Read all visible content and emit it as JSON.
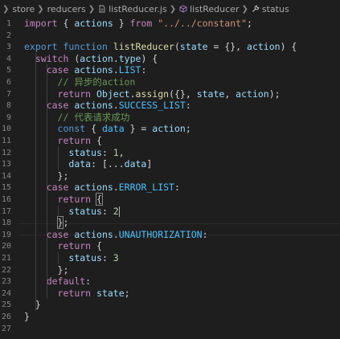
{
  "breadcrumb": {
    "items": [
      "store",
      "reducers",
      "listReducer.js",
      "listReducer",
      "status"
    ]
  },
  "editor": {
    "line_numbers": [
      "1",
      "2",
      "3",
      "4",
      "5",
      "6",
      "7",
      "8",
      "9",
      "10",
      "11",
      "12",
      "13",
      "14",
      "15",
      "16",
      "17",
      "18",
      "19",
      "20",
      "21",
      "22",
      "23",
      "24",
      "25",
      "26",
      "27"
    ],
    "lines": [
      [
        [
          "k",
          "import"
        ],
        [
          "p",
          " { "
        ],
        [
          "v",
          "actions"
        ],
        [
          "p",
          " } "
        ],
        [
          "k",
          "from"
        ],
        [
          "p",
          " "
        ],
        [
          "s",
          "\"../../constant\""
        ],
        [
          "p",
          ";"
        ]
      ],
      [],
      [
        [
          "kw",
          "export"
        ],
        [
          "p",
          " "
        ],
        [
          "kw",
          "function"
        ],
        [
          "p",
          " "
        ],
        [
          "f",
          "listReducer"
        ],
        [
          "p",
          "("
        ],
        [
          "v",
          "state"
        ],
        [
          "p",
          " = {}, "
        ],
        [
          "v",
          "action"
        ],
        [
          "p",
          ") {"
        ]
      ],
      [
        [
          "p",
          "  "
        ],
        [
          "k",
          "switch"
        ],
        [
          "p",
          " ("
        ],
        [
          "v",
          "action"
        ],
        [
          "p",
          "."
        ],
        [
          "v",
          "type"
        ],
        [
          "p",
          ") {"
        ]
      ],
      [
        [
          "p",
          "    "
        ],
        [
          "k",
          "case"
        ],
        [
          "p",
          " "
        ],
        [
          "v",
          "actions"
        ],
        [
          "p",
          "."
        ],
        [
          "cst",
          "LIST"
        ],
        [
          "p",
          ":"
        ]
      ],
      [
        [
          "p",
          "      "
        ],
        [
          "c",
          "// 异步的action"
        ]
      ],
      [
        [
          "p",
          "      "
        ],
        [
          "k",
          "return"
        ],
        [
          "p",
          " "
        ],
        [
          "v",
          "Object"
        ],
        [
          "p",
          "."
        ],
        [
          "f",
          "assign"
        ],
        [
          "p",
          "({}, "
        ],
        [
          "v",
          "state"
        ],
        [
          "p",
          ", "
        ],
        [
          "v",
          "action"
        ],
        [
          "p",
          ");"
        ]
      ],
      [
        [
          "p",
          "    "
        ],
        [
          "k",
          "case"
        ],
        [
          "p",
          " "
        ],
        [
          "v",
          "actions"
        ],
        [
          "p",
          "."
        ],
        [
          "cst",
          "SUCCESS_LIST"
        ],
        [
          "p",
          ":"
        ]
      ],
      [
        [
          "p",
          "      "
        ],
        [
          "c",
          "// 代表请求成功"
        ]
      ],
      [
        [
          "p",
          "      "
        ],
        [
          "kw",
          "const"
        ],
        [
          "p",
          " { "
        ],
        [
          "cst",
          "data"
        ],
        [
          "p",
          " } = "
        ],
        [
          "v",
          "action"
        ],
        [
          "p",
          ";"
        ]
      ],
      [
        [
          "p",
          "      "
        ],
        [
          "k",
          "return"
        ],
        [
          "p",
          " {"
        ]
      ],
      [
        [
          "p",
          "        "
        ],
        [
          "v",
          "status"
        ],
        [
          "p",
          ": "
        ],
        [
          "n",
          "1"
        ],
        [
          "p",
          ","
        ]
      ],
      [
        [
          "p",
          "        "
        ],
        [
          "v",
          "data"
        ],
        [
          "p",
          ": [..."
        ],
        [
          "v",
          "data"
        ],
        [
          "p",
          "]"
        ]
      ],
      [
        [
          "p",
          "      };"
        ]
      ],
      [
        [
          "p",
          "    "
        ],
        [
          "k",
          "case"
        ],
        [
          "p",
          " "
        ],
        [
          "v",
          "actions"
        ],
        [
          "p",
          "."
        ],
        [
          "cst",
          "ERROR_LIST"
        ],
        [
          "p",
          ":"
        ]
      ],
      [
        [
          "p",
          "      "
        ],
        [
          "k",
          "return"
        ],
        [
          "p",
          " "
        ],
        [
          "bm",
          "{"
        ]
      ],
      [
        [
          "p",
          "        "
        ],
        [
          "v",
          "status"
        ],
        [
          "p",
          ": "
        ],
        [
          "n",
          "2"
        ],
        [
          "cur",
          ""
        ]
      ],
      [
        [
          "p",
          "      "
        ],
        [
          "bm",
          "}"
        ],
        [
          "p",
          ";"
        ]
      ],
      [
        [
          "p",
          "    "
        ],
        [
          "k",
          "case"
        ],
        [
          "p",
          " "
        ],
        [
          "v",
          "actions"
        ],
        [
          "p",
          "."
        ],
        [
          "cst",
          "UNAUTHORIZATION"
        ],
        [
          "p",
          ":"
        ]
      ],
      [
        [
          "p",
          "      "
        ],
        [
          "k",
          "return"
        ],
        [
          "p",
          " {"
        ]
      ],
      [
        [
          "p",
          "        "
        ],
        [
          "v",
          "status"
        ],
        [
          "p",
          ": "
        ],
        [
          "n",
          "3"
        ]
      ],
      [
        [
          "p",
          "      };"
        ]
      ],
      [
        [
          "p",
          "    "
        ],
        [
          "k",
          "default"
        ],
        [
          "p",
          ":"
        ]
      ],
      [
        [
          "p",
          "      "
        ],
        [
          "k",
          "return"
        ],
        [
          "p",
          " "
        ],
        [
          "v",
          "state"
        ],
        [
          "p",
          ";"
        ]
      ],
      [
        [
          "p",
          "  }"
        ]
      ],
      [
        [
          "p",
          "}"
        ]
      ],
      []
    ]
  },
  "icons": {
    "breadcrumb_separator": "chevron-right-icon",
    "file_icon": "js-file-icon",
    "function_icon": "cube-icon",
    "property_icon": "wrench-icon"
  }
}
